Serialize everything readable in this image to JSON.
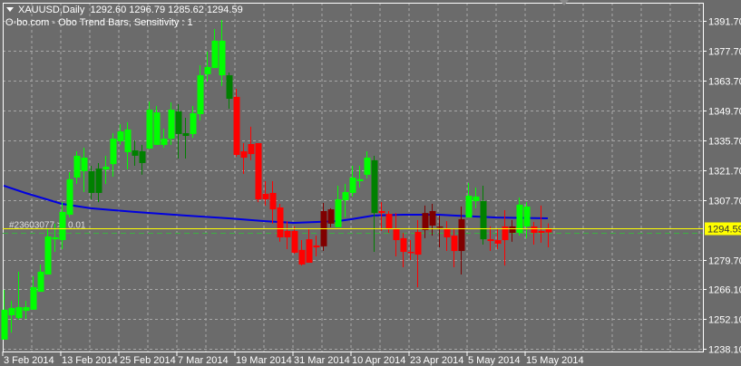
{
  "header": {
    "symbol": "XAUUSD,Daily",
    "ohlc": "1292.60 1296.79 1285.62 1294.59",
    "indicator": "O-bo.com - Obo Trend Bars, Sensitivity : 1"
  },
  "order_line": {
    "label": "#23603077 >",
    "lots": "0.01",
    "price": 1294.59,
    "color": "#ffff00"
  },
  "stop_line": {
    "price": 1292.4,
    "color": "#3cb043"
  },
  "current_price_label": "1294.59",
  "colors": {
    "bull": "#00ff00",
    "bull_weak": "#008000",
    "bear": "#ff0000",
    "bear_weak": "#800000",
    "ma": "#0000e0",
    "grid": "#a8a8a8",
    "background": "#6b6b6b"
  },
  "chart_data": {
    "type": "candlestick",
    "symbol": "XAUUSD",
    "timeframe": "Daily",
    "ylim": [
      1238.1,
      1391.7
    ],
    "y_ticks": [
      "1391.70",
      "1377.70",
      "1363.70",
      "1349.70",
      "1335.70",
      "1321.70",
      "1307.70",
      "1279.70",
      "1266.10",
      "1252.10",
      "1238.10"
    ],
    "x_ticks": [
      {
        "bar": 0,
        "label": "3 Feb 2014"
      },
      {
        "bar": 8,
        "label": "13 Feb 2014"
      },
      {
        "bar": 16,
        "label": "25 Feb 2014"
      },
      {
        "bar": 24,
        "label": "7 Mar 2014"
      },
      {
        "bar": 32,
        "label": "19 Mar 2014"
      },
      {
        "bar": 40,
        "label": "31 Mar 2014"
      },
      {
        "bar": 48,
        "label": "10 Apr 2014"
      },
      {
        "bar": 56,
        "label": "23 Apr 2014"
      },
      {
        "bar": 64,
        "label": "5 May 2014"
      },
      {
        "bar": 72,
        "label": "15 May 2014"
      }
    ],
    "bars": [
      [
        1242.4,
        1265.7,
        1242.4,
        1256.4,
        "bull"
      ],
      [
        1253.8,
        1260.6,
        1245.7,
        1257.2,
        "bull"
      ],
      [
        1252.5,
        1274.2,
        1251.7,
        1257.6,
        "bull"
      ],
      [
        1255.9,
        1260.6,
        1252.1,
        1257.6,
        "bull"
      ],
      [
        1256.4,
        1272.1,
        1256.4,
        1267.0,
        "bull"
      ],
      [
        1264.8,
        1277.6,
        1264.8,
        1274.2,
        "bull"
      ],
      [
        1272.9,
        1294.1,
        1272.9,
        1290.7,
        "bull"
      ],
      [
        1289.4,
        1296.7,
        1283.5,
        1290.3,
        "bull"
      ],
      [
        1289.0,
        1306.8,
        1284.8,
        1302.2,
        "bull"
      ],
      [
        1300.9,
        1320.8,
        1299.6,
        1317.5,
        "bull"
      ],
      [
        1318.3,
        1330.6,
        1315.3,
        1328.5,
        "bull"
      ],
      [
        1321.3,
        1332.3,
        1311.5,
        1327.6,
        "bull"
      ],
      [
        1321.3,
        1323.8,
        1308.1,
        1311.1,
        "bull_weak"
      ],
      [
        1322.5,
        1325.1,
        1306.8,
        1311.1,
        "bull_weak"
      ],
      [
        1322.1,
        1328.5,
        1315.3,
        1323.4,
        "bull"
      ],
      [
        1324.6,
        1339.1,
        1318.7,
        1336.5,
        "bull"
      ],
      [
        1335.3,
        1343.3,
        1333.6,
        1339.9,
        "bull"
      ],
      [
        1330.2,
        1344.2,
        1322.1,
        1340.8,
        "bull"
      ],
      [
        1331.0,
        1335.7,
        1323.8,
        1328.5,
        "bull_weak"
      ],
      [
        1330.6,
        1333.6,
        1319.6,
        1325.1,
        "bull_weak"
      ],
      [
        1331.9,
        1353.9,
        1331.5,
        1350.1,
        "bull"
      ],
      [
        1333.6,
        1351.8,
        1333.6,
        1348.8,
        "bull"
      ],
      [
        1333.6,
        1341.2,
        1332.3,
        1336.5,
        "bull"
      ],
      [
        1336.5,
        1353.5,
        1333.6,
        1350.1,
        "bull"
      ],
      [
        1349.3,
        1352.7,
        1327.2,
        1338.7,
        "bull_weak"
      ],
      [
        1339.1,
        1346.3,
        1327.2,
        1337.8,
        "bull_weak"
      ],
      [
        1338.7,
        1351.8,
        1336.9,
        1348.4,
        "bull"
      ],
      [
        1348.0,
        1370.9,
        1345.0,
        1366.2,
        "bull"
      ],
      [
        1366.7,
        1377.3,
        1363.3,
        1370.1,
        "bull"
      ],
      [
        1369.6,
        1387.9,
        1369.6,
        1382.4,
        "bull"
      ],
      [
        1366.2,
        1392.1,
        1361.2,
        1382.4,
        "bull"
      ],
      [
        1366.2,
        1367.5,
        1350.5,
        1355.2,
        "bull_weak"
      ],
      [
        1356.1,
        1359.9,
        1328.1,
        1328.9,
        "bear"
      ],
      [
        1330.6,
        1334.4,
        1320.0,
        1327.6,
        "bear"
      ],
      [
        1334.0,
        1342.1,
        1326.4,
        1329.3,
        "bear"
      ],
      [
        1334.4,
        1334.4,
        1306.8,
        1308.1,
        "bear"
      ],
      [
        1310.7,
        1316.6,
        1305.2,
        1308.1,
        "bear"
      ],
      [
        1311.1,
        1316.6,
        1296.7,
        1303.4,
        "bear"
      ],
      [
        1304.3,
        1306.0,
        1288.2,
        1290.3,
        "bear"
      ],
      [
        1293.3,
        1297.9,
        1284.8,
        1290.3,
        "bear"
      ],
      [
        1293.3,
        1295.4,
        1282.6,
        1283.1,
        "bear"
      ],
      [
        1284.4,
        1289.0,
        1277.1,
        1277.6,
        "bear"
      ],
      [
        1289.4,
        1294.1,
        1278.4,
        1278.4,
        "bear"
      ],
      [
        1286.5,
        1291.1,
        1281.4,
        1285.6,
        "bear"
      ],
      [
        1286.1,
        1306.4,
        1283.9,
        1302.6,
        "bear_weak"
      ],
      [
        1296.7,
        1303.9,
        1295.0,
        1303.4,
        "bear_weak"
      ],
      [
        1295.0,
        1314.5,
        1295.0,
        1308.1,
        "bull"
      ],
      [
        1307.7,
        1315.3,
        1299.6,
        1311.5,
        "bull"
      ],
      [
        1311.1,
        1323.8,
        1309.4,
        1318.3,
        "bull"
      ],
      [
        1316.6,
        1323.8,
        1313.6,
        1317.5,
        "bull"
      ],
      [
        1319.6,
        1330.6,
        1317.9,
        1327.6,
        "bull"
      ],
      [
        1326.4,
        1328.5,
        1283.5,
        1301.7,
        "bull_weak"
      ],
      [
        1302.6,
        1306.8,
        1293.3,
        1301.7,
        "bear"
      ],
      [
        1301.3,
        1302.6,
        1292.4,
        1294.5,
        "bear"
      ],
      [
        1294.1,
        1301.7,
        1281.4,
        1289.0,
        "bear"
      ],
      [
        1289.9,
        1292.4,
        1276.3,
        1283.5,
        "bear"
      ],
      [
        1283.5,
        1289.0,
        1279.7,
        1283.1,
        "bear"
      ],
      [
        1292.8,
        1298.4,
        1266.9,
        1282.2,
        "bear"
      ],
      [
        1293.7,
        1305.2,
        1289.9,
        1301.7,
        "bear_weak"
      ],
      [
        1295.8,
        1306.0,
        1291.1,
        1302.6,
        "bear_weak"
      ],
      [
        1295.0,
        1300.5,
        1285.6,
        1295.4,
        "bear_weak"
      ],
      [
        1294.5,
        1297.9,
        1283.9,
        1290.3,
        "bear"
      ],
      [
        1291.1,
        1294.1,
        1276.3,
        1283.9,
        "bear"
      ],
      [
        1283.9,
        1304.7,
        1272.9,
        1298.8,
        "bear_weak"
      ],
      [
        1299.6,
        1315.8,
        1299.6,
        1309.8,
        "bull"
      ],
      [
        1307.3,
        1313.6,
        1303.9,
        1309.4,
        "bull"
      ],
      [
        1307.3,
        1314.5,
        1286.9,
        1289.4,
        "bull_weak"
      ],
      [
        1289.4,
        1295.4,
        1283.9,
        1288.6,
        "bear"
      ],
      [
        1289.0,
        1294.1,
        1284.8,
        1287.3,
        "bear"
      ],
      [
        1295.4,
        1303.0,
        1277.1,
        1289.0,
        "bear"
      ],
      [
        1292.4,
        1298.4,
        1288.2,
        1295.4,
        "bear_weak"
      ],
      [
        1292.4,
        1308.9,
        1291.1,
        1305.6,
        "bull"
      ],
      [
        1295.4,
        1306.8,
        1289.9,
        1304.7,
        "bull"
      ],
      [
        1295.4,
        1297.5,
        1286.9,
        1292.4,
        "bear"
      ],
      [
        1293.3,
        1305.2,
        1287.8,
        1292.4,
        "bear"
      ],
      [
        1292.6,
        1296.79,
        1285.62,
        1294.59,
        "bear"
      ]
    ],
    "moving_average": [
      [
        0,
        1314.5
      ],
      [
        3,
        1311.1
      ],
      [
        8,
        1306.0
      ],
      [
        12,
        1303.9
      ],
      [
        18,
        1302.2
      ],
      [
        25,
        1300.5
      ],
      [
        31,
        1299.2
      ],
      [
        36,
        1297.9
      ],
      [
        40,
        1297.1
      ],
      [
        46,
        1297.9
      ],
      [
        48,
        1298.8
      ],
      [
        51,
        1300.5
      ],
      [
        55,
        1300.9
      ],
      [
        60,
        1300.9
      ],
      [
        62,
        1300.5
      ],
      [
        68,
        1299.6
      ],
      [
        75,
        1299.2
      ]
    ]
  }
}
